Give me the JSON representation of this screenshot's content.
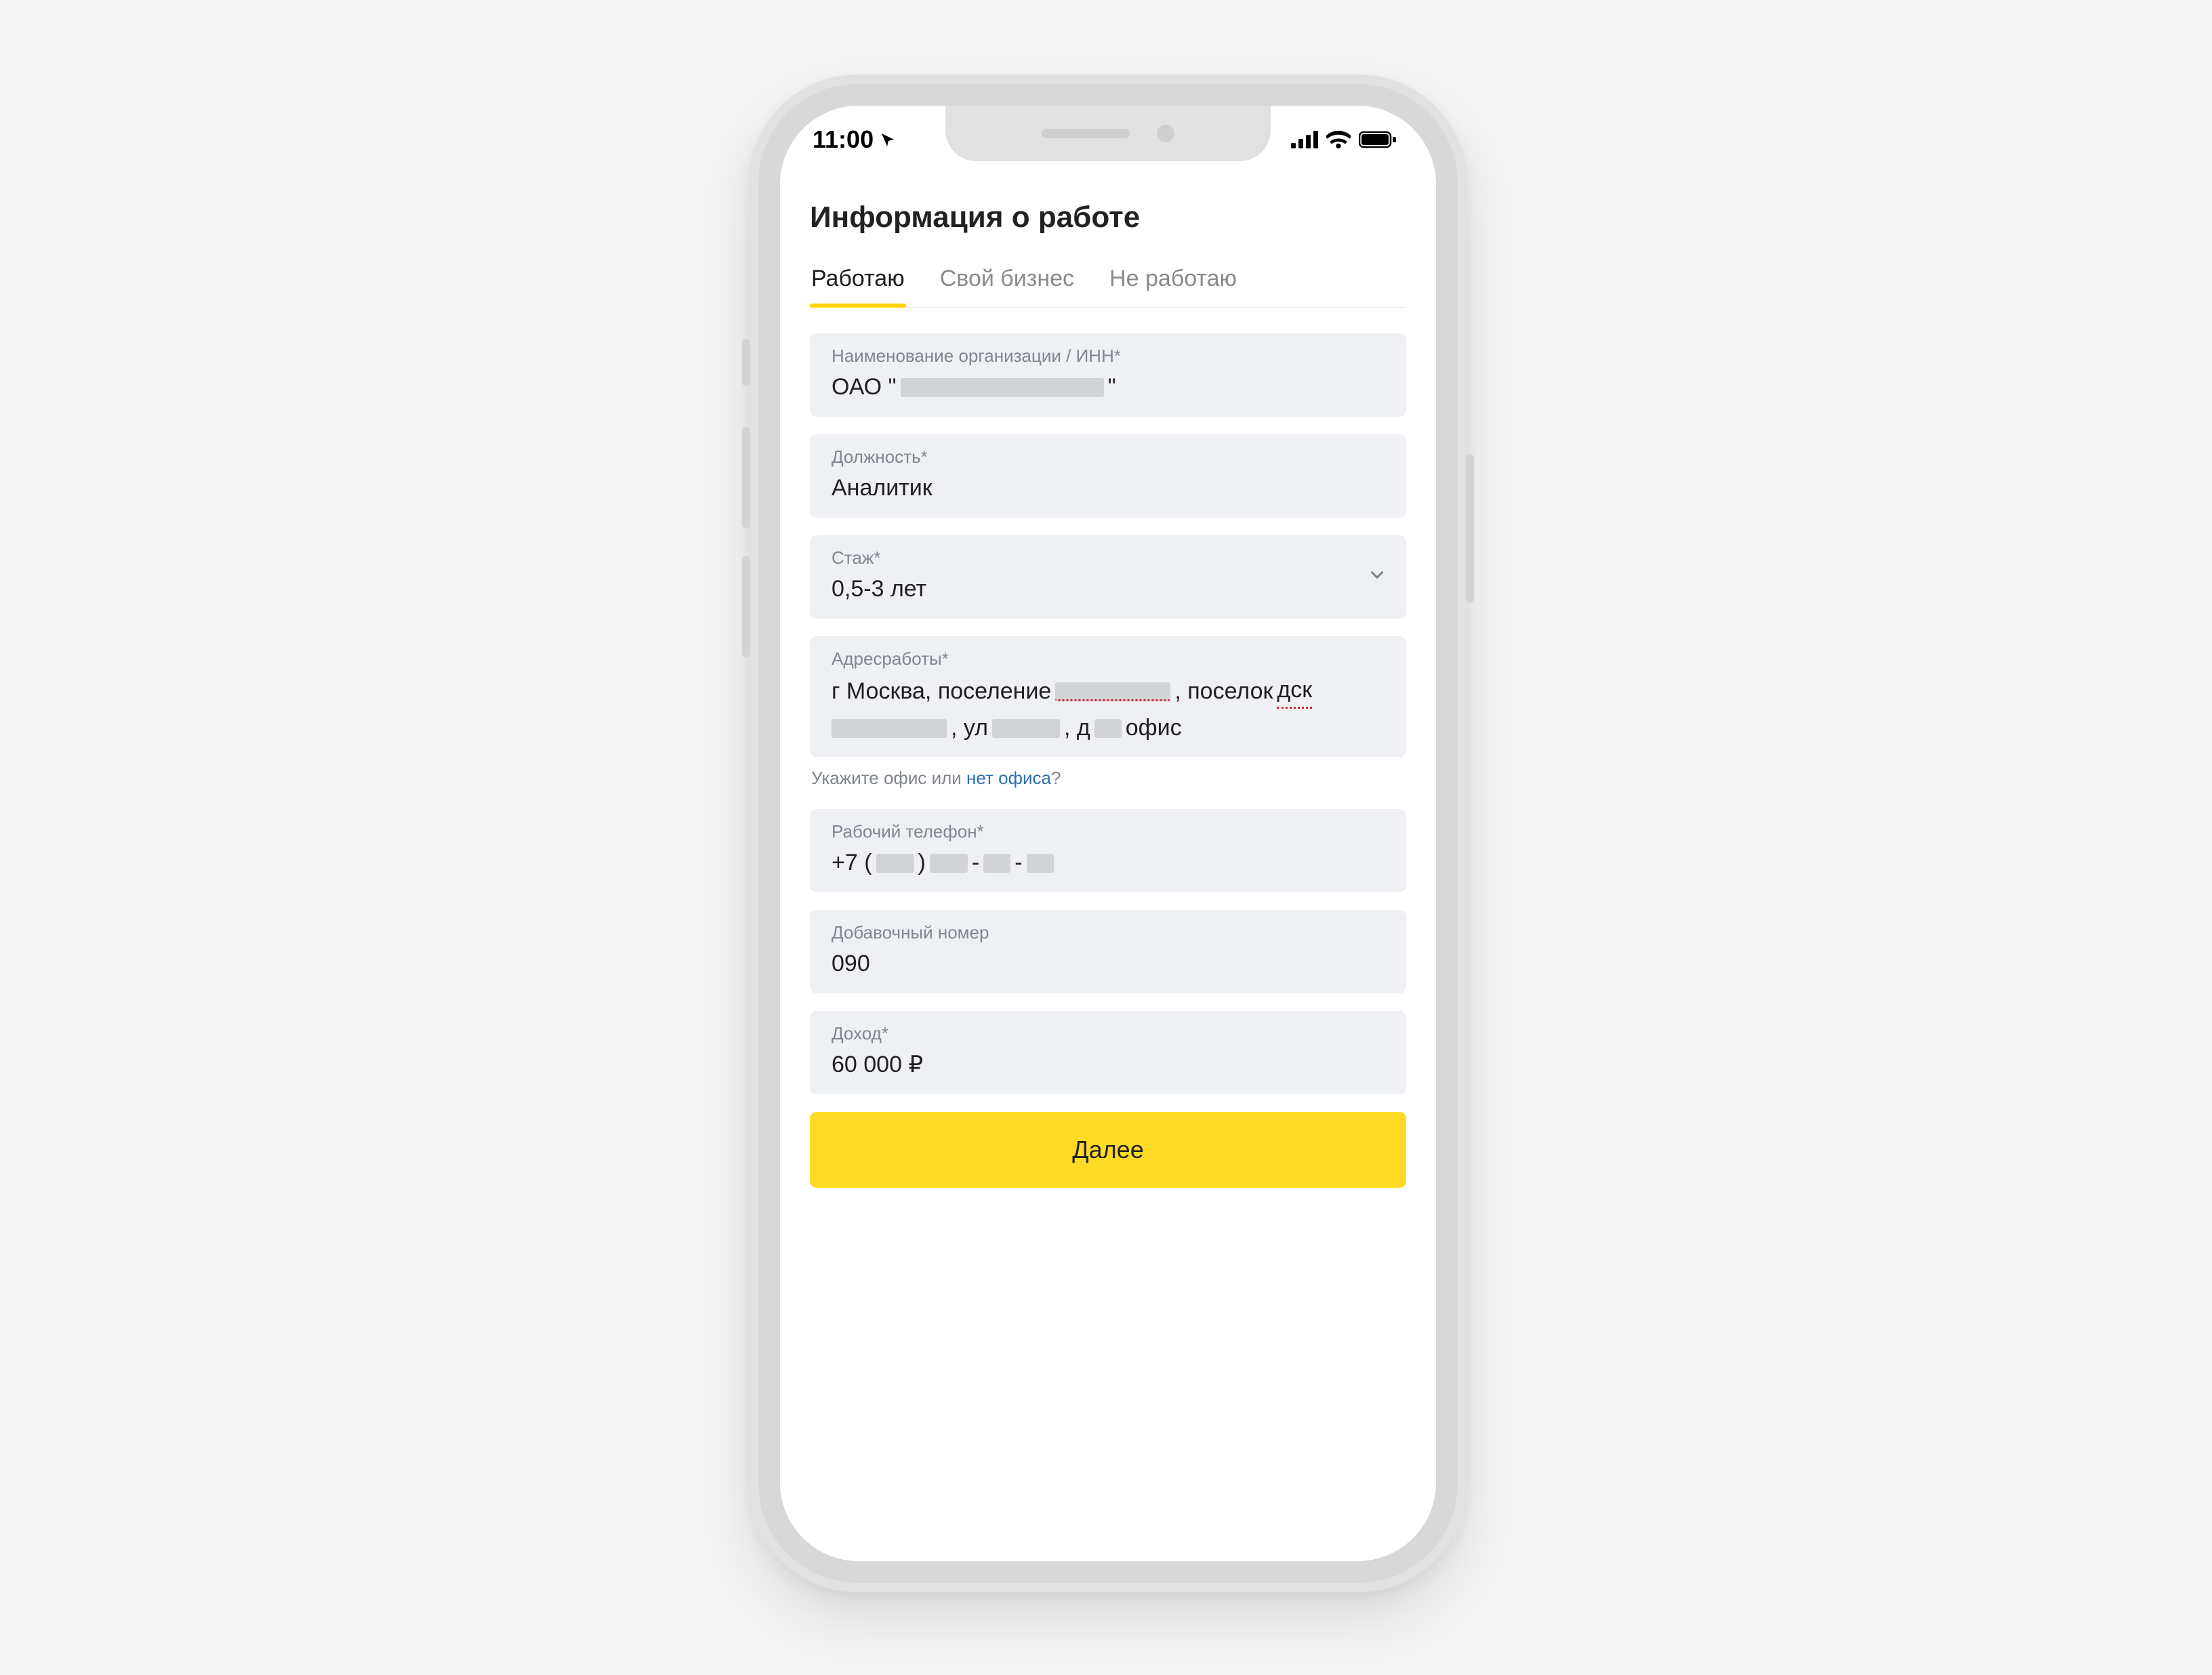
{
  "status": {
    "time": "11:00"
  },
  "page": {
    "title": "Информация о работе",
    "tabs": [
      {
        "label": "Работаю",
        "active": true
      },
      {
        "label": "Свой бизнес",
        "active": false
      },
      {
        "label": "Не работаю",
        "active": false
      }
    ]
  },
  "form": {
    "org": {
      "label": "Наименование организации / ИНН*",
      "prefix": "ОАО \"",
      "suffix": "\""
    },
    "position": {
      "label": "Должность*",
      "value": "Аналитик"
    },
    "tenure": {
      "label": "Стаж*",
      "value": "0,5-3 лет"
    },
    "address": {
      "label": "Адресработы*",
      "line1_a": "г Москва, поселение ",
      "line1_b": ", поселок ",
      "line1_c": "дск",
      "line2_a": ", ул ",
      "line2_b": ", д ",
      "line2_c": " офис"
    },
    "office_hint": {
      "text": "Укажите офис или ",
      "link": "нет офиса",
      "suffix": "?"
    },
    "phone": {
      "label": "Рабочий телефон*",
      "prefix": "+7 (",
      "sep1": ") ",
      "dash": "-"
    },
    "ext": {
      "label": "Добавочный номер",
      "value": "090"
    },
    "income": {
      "label": "Доход*",
      "value": "60 000 ₽"
    }
  },
  "actions": {
    "next": "Далее"
  }
}
